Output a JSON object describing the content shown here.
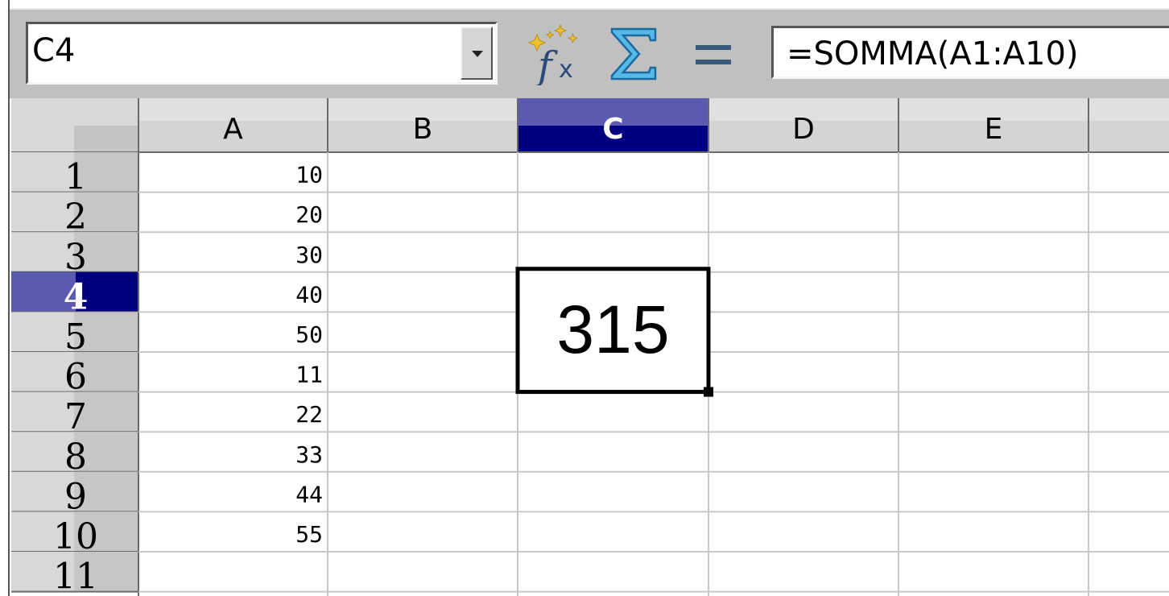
{
  "name_box": {
    "value": "C4"
  },
  "formula_bar": {
    "value": "=SOMMA(A1:A10)"
  },
  "toolbar": {
    "icons": [
      "function-wizard-icon",
      "sum-icon",
      "equals-icon"
    ]
  },
  "columns": [
    "A",
    "B",
    "C",
    "D",
    "E"
  ],
  "rows": [
    "1",
    "2",
    "3",
    "4",
    "5",
    "6",
    "7",
    "8",
    "9",
    "10",
    "11"
  ],
  "column_a_values": [
    "10",
    "20",
    "30",
    "40",
    "50",
    "11",
    "22",
    "33",
    "44",
    "55",
    ""
  ],
  "active_cell": {
    "column": "C",
    "row": "4",
    "display_value": "315"
  },
  "colors": {
    "selection_header": "#000080",
    "selection_header_light": "#5a5ab0",
    "header_gray": "#d4d4d4",
    "gridline": "#c8c8c8",
    "toolbar": "#c0c0c0",
    "sigma_blue": "#3aa0d8",
    "fx_gold": "#e8c020"
  }
}
